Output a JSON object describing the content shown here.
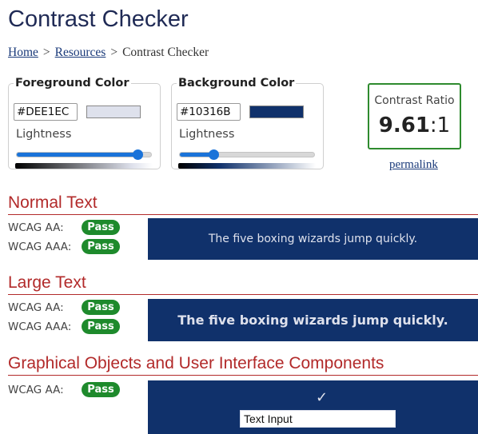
{
  "page": {
    "title": "Contrast Checker"
  },
  "breadcrumb": {
    "home": "Home",
    "sep1": ">",
    "resources": "Resources",
    "sep2": ">",
    "current": "Contrast Checker"
  },
  "foreground": {
    "legend": "Foreground Color",
    "hex": "#DEE1EC",
    "swatch_color": "#DEE1EC",
    "lightness_label": "Lightness",
    "lightness_fraction": 0.9
  },
  "background": {
    "legend": "Background Color",
    "hex": "#10316B",
    "swatch_color": "#10316B",
    "lightness_label": "Lightness",
    "lightness_fraction": 0.25
  },
  "ratio": {
    "label": "Contrast Ratio",
    "value": "9.61",
    "suffix": ":1",
    "permalink": "permalink"
  },
  "normal_text": {
    "heading": "Normal Text",
    "aa_label": "WCAG AA:",
    "aa_result": "Pass",
    "aaa_label": "WCAG AAA:",
    "aaa_result": "Pass",
    "sample": "The five boxing wizards jump quickly."
  },
  "large_text": {
    "heading": "Large Text",
    "aa_label": "WCAG AA:",
    "aa_result": "Pass",
    "aaa_label": "WCAG AAA:",
    "aaa_result": "Pass",
    "sample": "The five boxing wizards jump quickly."
  },
  "graphical": {
    "heading": "Graphical Objects and User Interface Components",
    "aa_label": "WCAG AA:",
    "aa_result": "Pass",
    "checkmark": "✓",
    "input_value": "Text Input"
  },
  "colors": {
    "pass_green": "#1E8A2C",
    "heading_red": "#B22A2A",
    "ratio_border": "#2E8B2E",
    "slider_blue": "#1A73D9"
  }
}
